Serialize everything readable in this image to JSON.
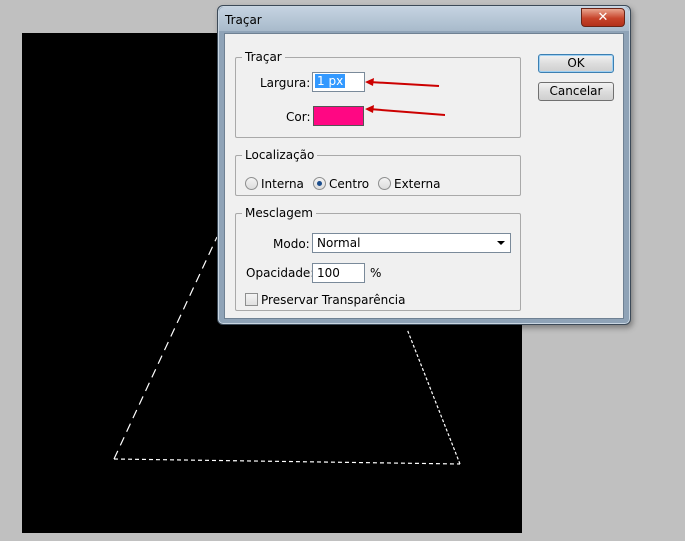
{
  "dialog": {
    "title": "Traçar",
    "close_glyph": "✕",
    "ok_label": "OK",
    "cancel_label": "Cancelar"
  },
  "stroke": {
    "legend": "Traçar",
    "width_label": "Largura:",
    "width_value": "1 px",
    "color_label": "Cor:",
    "color_value": "#ff0783"
  },
  "location": {
    "legend": "Localização",
    "options": [
      "Interna",
      "Centro",
      "Externa"
    ],
    "selected": "Centro"
  },
  "blending": {
    "legend": "Mesclagem",
    "mode_label": "Modo:",
    "mode_value": "Normal",
    "opacity_label": "Opacidade:",
    "opacity_value": "100",
    "opacity_unit": "%",
    "preserve_label": "Preservar Transparência",
    "preserve_checked": false
  },
  "colors": {
    "canvas": "#000000",
    "annotation_arrow": "#cc0000",
    "selection": "#ffffff"
  },
  "icons": {
    "close": "close-icon",
    "dropdown": "chevron-down-icon",
    "annotation": "red-arrow-icon"
  }
}
